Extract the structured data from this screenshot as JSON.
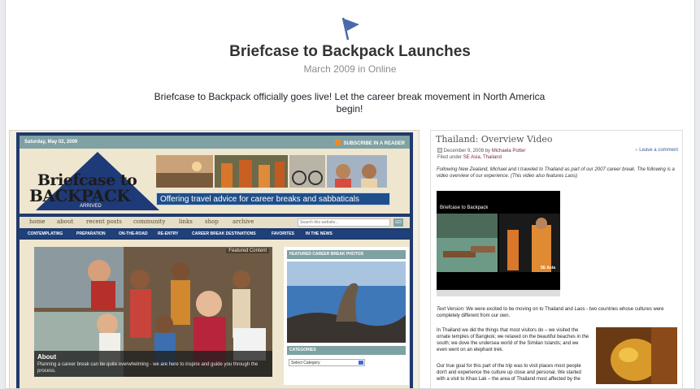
{
  "post": {
    "title": "Briefcase to Backpack Launches",
    "subtitle": "March 2009 in Online",
    "description": "Briefcase to Backpack officially goes live! Let the career break movement in North America begin!"
  },
  "website": {
    "date": "Saturday, May 02, 2009",
    "subscribe": "SUBSCRIBE IN A READER",
    "logo_line1": "Briefcase to",
    "logo_line2": "BACKPACK",
    "logo_badge": "ARRIVED",
    "tagline": "Offering travel advice for career breaks and sabbaticals",
    "nav": [
      "home",
      "about",
      "recent posts",
      "community",
      "links",
      "shop",
      "archive"
    ],
    "search_placeholder": "Search this website...",
    "go": "GO",
    "subnav": [
      "CONTEMPLATING",
      "PREPARATION",
      "ON-THE-ROAD",
      "RE-ENTRY",
      "CAREER BREAK DESTINATIONS",
      "FAVORITES",
      "IN THE NEWS"
    ],
    "featured_label": "Featured Content",
    "about_title": "About",
    "about_text": "Planning a career break can be quite overwhelming - we are here to inspire and guide you through the process.",
    "featured_photos": "FEATURED CAREER BREAK PHOTOS",
    "categories": "CATEGORIES",
    "select_category": "Select Category"
  },
  "article": {
    "title": "Thailand: Overview Video",
    "date": "December 9, 2008 by",
    "author": "Michaela Potter",
    "filed": "Filed under",
    "filed_links": "SE Asia, Thailand",
    "comment": "Leave a comment",
    "intro": "Following New Zealand, Michael and I traveled to Thailand as part of our 2007 career break. The following is a video overview of our experience. (This video also features Laos)",
    "video_title": "Briefcase to Backpack",
    "video_label": "SE Asia",
    "version_label": "Text Version:",
    "version_text": "We were excited to be moving on to Thailand and Laos - two countries whose cultures were completely different from our own.",
    "p1": "In Thailand we did the things that most visitors do – we visited the ornate temples of Bangkok; we relaxed on the beautiful beaches in the south; we dove the undersea world of the Similan Islands; and we even went on an elephant trek.",
    "p2": "Our true goal for this part of the trip was to visit places most people don't and experience the culture up close and personal. We started with a visit to Khao Lak – the area of Thailand most affected by the"
  },
  "colors": {
    "brand_blue": "#20407a",
    "teal": "#7fa1a3",
    "flag": "#4a69ad"
  }
}
